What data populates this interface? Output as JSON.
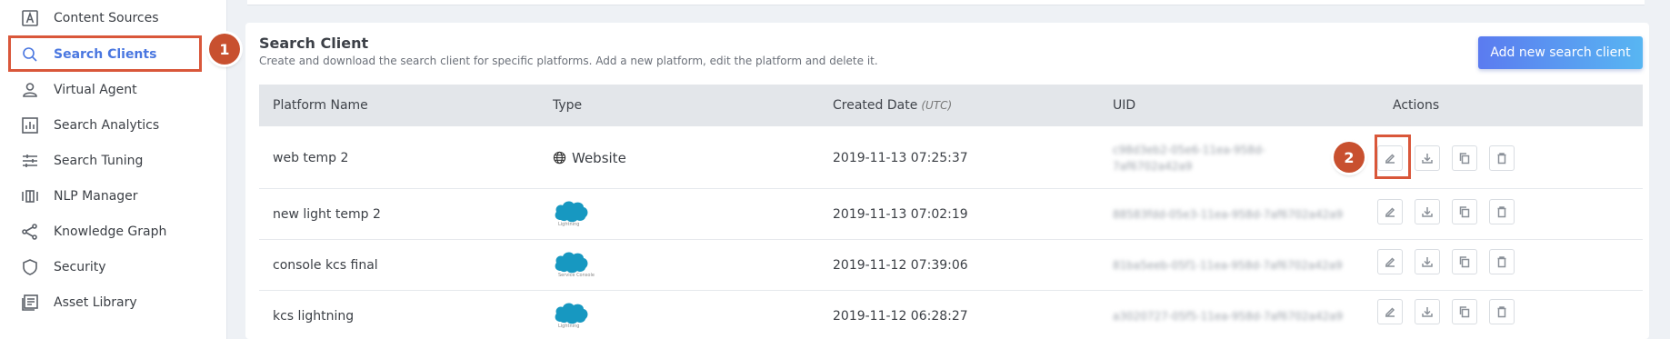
{
  "sidebar": {
    "items": [
      {
        "label": "Content Sources",
        "icon": "content-sources-icon"
      },
      {
        "label": "Search Clients",
        "icon": "search-icon",
        "active": true
      },
      {
        "label": "Virtual Agent",
        "icon": "user-icon"
      },
      {
        "label": "Search Analytics",
        "icon": "analytics-icon"
      },
      {
        "label": "Search Tuning",
        "icon": "tuning-icon"
      },
      {
        "label": "NLP Manager",
        "icon": "nlp-icon"
      },
      {
        "label": "Knowledge Graph",
        "icon": "share-icon"
      },
      {
        "label": "Security",
        "icon": "shield-icon"
      },
      {
        "label": "Asset Library",
        "icon": "library-icon"
      }
    ]
  },
  "callouts": {
    "one": "1",
    "two": "2"
  },
  "page": {
    "title": "Search Client",
    "subtitle": "Create and download the search client for specific platforms. Add a new platform, edit the platform and delete it.",
    "add_button": "Add new search client"
  },
  "table": {
    "headers": {
      "platform_name": "Platform Name",
      "type": "Type",
      "created_date": "Created Date",
      "created_date_suffix": "(UTC)",
      "uid": "UID",
      "actions": "Actions"
    },
    "rows": [
      {
        "name": "web temp 2",
        "type": "Website",
        "type_icon": "globe-icon",
        "created": "2019-11-13 07:25:37",
        "uid": "c98d3eb2-05e6-11ea-958d-7af6702a42a9"
      },
      {
        "name": "new light temp 2",
        "type": "salesforce",
        "type_sub": "Lightning",
        "type_icon": "salesforce-logo",
        "created": "2019-11-13 07:02:19",
        "uid": "88583fdd-05e3-11ea-958d-7af6702a42a9"
      },
      {
        "name": "console kcs final",
        "type": "salesforce",
        "type_sub": "Service Console",
        "type_icon": "salesforce-logo",
        "created": "2019-11-12 07:39:06",
        "uid": "81ba5eeb-05f1-11ea-958d-7af6702a42a9"
      },
      {
        "name": "kcs lightning",
        "type": "salesforce",
        "type_sub": "Lightning",
        "type_icon": "salesforce-logo",
        "created": "2019-11-12 06:28:27",
        "uid": "a3020727-05f5-11ea-958d-7af6702a42a9"
      }
    ]
  },
  "colors": {
    "accent": "#4a77e0",
    "highlight": "#d9573a",
    "badge": "#c8502f",
    "salesforce": "#1798c1"
  }
}
